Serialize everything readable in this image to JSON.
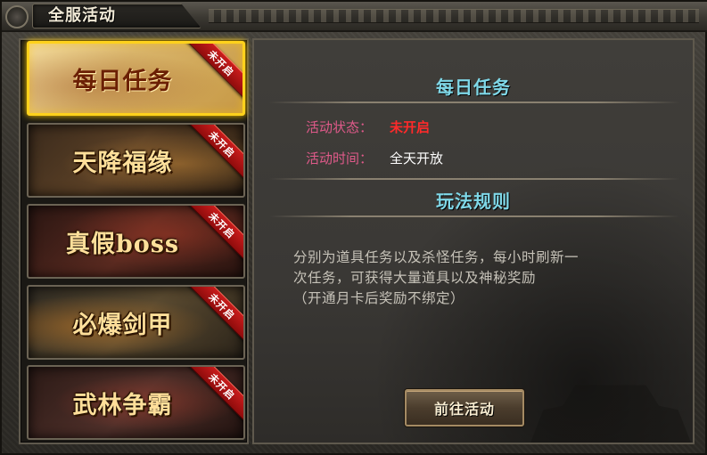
{
  "window": {
    "title": "全服活动"
  },
  "activities": [
    {
      "name": "每日任务",
      "ribbon": "未开启",
      "active": true
    },
    {
      "name": "天降福缘",
      "ribbon": "未开启",
      "active": false
    },
    {
      "name": "真假boss",
      "ribbon": "未开启",
      "active": false
    },
    {
      "name": "必爆剑甲",
      "ribbon": "未开启",
      "active": false
    },
    {
      "name": "武林争霸",
      "ribbon": "未开启",
      "active": false
    }
  ],
  "detail": {
    "title": "每日任务",
    "status_label": "活动状态：",
    "status_value": "未开启",
    "time_label": "活动时间：",
    "time_value": "全天开放",
    "rules_title": "玩法规则",
    "rules_line1": "分别为道具任务以及杀怪任务，每小时刷新一",
    "rules_line2": "次任务，可获得大量道具以及神秘奖励",
    "rules_line3": "（开通月卡后奖励不绑定）",
    "go_button": "前往活动"
  },
  "colors": {
    "accent_cyan": "#7fd8e8",
    "status_red": "#ff2a2a",
    "label_pink": "#e05a8a",
    "ribbon_red": "#c91c1c",
    "active_gold": "#ffd21c"
  }
}
